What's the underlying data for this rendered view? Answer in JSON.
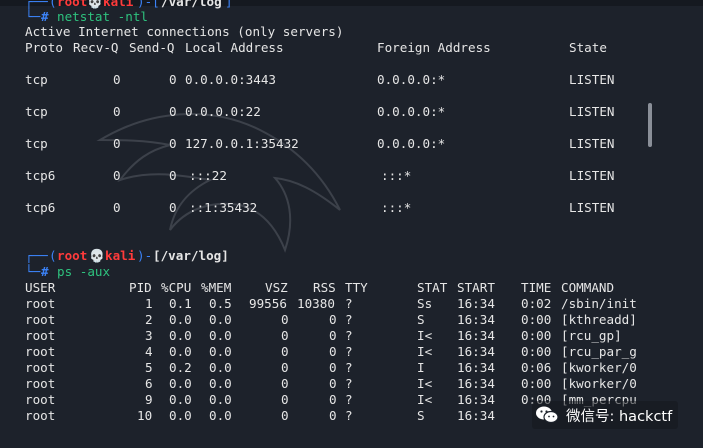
{
  "session1": {
    "prompt": {
      "open": "└─",
      "user": "(root💀kali)",
      "path": "-[/var/log]",
      "hash": "#"
    },
    "command": "netstat -ntl",
    "title_line": "Active Internet connections (only servers)",
    "headers": [
      "Proto",
      "Recv-Q",
      "Send-Q",
      "Local Address",
      "Foreign Address",
      "State"
    ],
    "rows": [
      [
        "tcp",
        "0",
        "0",
        "0.0.0.0:3443",
        "0.0.0.0:*",
        "LISTEN"
      ],
      [
        "tcp",
        "0",
        "0",
        "0.0.0.0:22",
        "0.0.0.0:*",
        "LISTEN"
      ],
      [
        "tcp",
        "0",
        "0",
        "127.0.0.1:35432",
        "0.0.0.0:*",
        "LISTEN"
      ],
      [
        "tcp6",
        "0",
        "0",
        ":::22",
        ":::*",
        "LISTEN"
      ],
      [
        "tcp6",
        "0",
        "0",
        "::1:35432",
        ":::*",
        "LISTEN"
      ]
    ]
  },
  "session2": {
    "prompt": {
      "frame_top": "┌──",
      "user": "root",
      "skull": "💀",
      "host": "kali",
      "path": "[/var/log]",
      "frame_bottom": "└─",
      "hash": "#"
    },
    "command": "ps -aux",
    "headers": [
      "USER",
      "PID",
      "%CPU",
      "%MEM",
      "VSZ",
      "RSS",
      "TTY",
      "STAT",
      "START",
      "TIME",
      "COMMAND"
    ],
    "rows": [
      [
        "root",
        "1",
        "0.1",
        "0.5",
        "99556",
        "10380",
        "?",
        "Ss",
        "16:34",
        "0:02",
        "/sbin/init"
      ],
      [
        "root",
        "2",
        "0.0",
        "0.0",
        "0",
        "0",
        "?",
        "S",
        "16:34",
        "0:00",
        "[kthreadd]"
      ],
      [
        "root",
        "3",
        "0.0",
        "0.0",
        "0",
        "0",
        "?",
        "I<",
        "16:34",
        "0:00",
        "[rcu_gp]"
      ],
      [
        "root",
        "4",
        "0.0",
        "0.0",
        "0",
        "0",
        "?",
        "I<",
        "16:34",
        "0:00",
        "[rcu_par_g"
      ],
      [
        "root",
        "5",
        "0.2",
        "0.0",
        "0",
        "0",
        "?",
        "I",
        "16:34",
        "0:06",
        "[kworker/0"
      ],
      [
        "root",
        "6",
        "0.0",
        "0.0",
        "0",
        "0",
        "?",
        "I<",
        "16:34",
        "0:00",
        "[kworker/0"
      ],
      [
        "root",
        "9",
        "0.0",
        "0.0",
        "0",
        "0",
        "?",
        "I<",
        "16:34",
        "0:00",
        "[mm_percpu"
      ],
      [
        "root",
        "10",
        "0.0",
        "0.0",
        "0",
        "0",
        "?",
        "S",
        "16:34",
        "0",
        ""
      ]
    ]
  },
  "watermark": {
    "text": "微信号: hackctf",
    "icon": "wechat-icon"
  },
  "colors": {
    "background": "#1d222b",
    "prompt_frame": "#3b82f6",
    "prompt_user": "#ff3b3b",
    "command": "#2ec27e"
  }
}
